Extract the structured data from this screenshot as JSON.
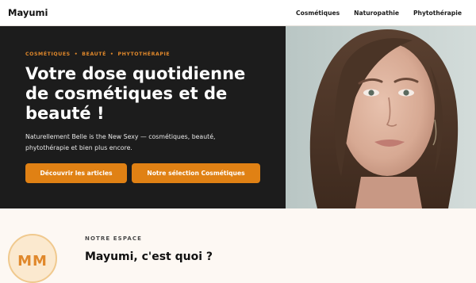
{
  "header": {
    "brand": "Mayumi",
    "nav": [
      "Cosmétiques",
      "Naturopathie",
      "Phytothérapie"
    ]
  },
  "hero": {
    "tags": [
      "COSMÉTIQUES",
      "BEAUTÉ",
      "PHYTOTHÉRAPIE"
    ],
    "tag_separator": "•",
    "headline": "Votre dose quotidienne de cosmétiques et de beauté !",
    "subtext": "Naturellement Belle is the New Sexy — cosmétiques, beauté, phytothérapie et bien plus encore.",
    "primary_button": "Découvrir les articles",
    "secondary_button": "Notre sélection Cosmétiques"
  },
  "about": {
    "avatar_initials": "MM",
    "eyebrow": "NOTRE ESPACE",
    "title": "Mayumi, c'est quoi ?"
  },
  "colors": {
    "accent": "#e08114",
    "hero_background": "#1c1c1c",
    "page_background": "#fdf8f3"
  }
}
